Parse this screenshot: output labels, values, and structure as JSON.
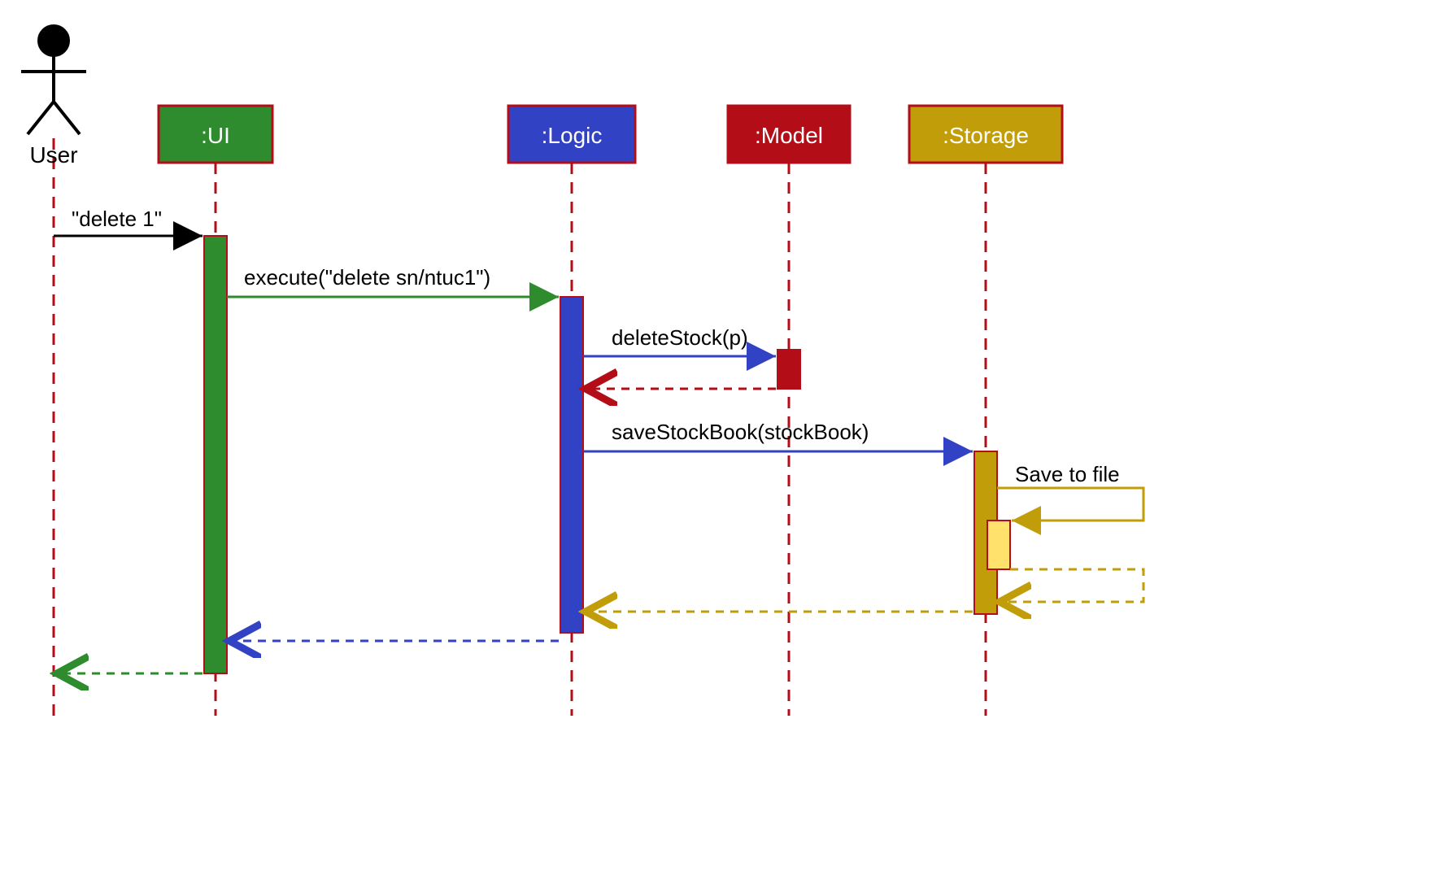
{
  "diagram": {
    "actor": {
      "label": "User"
    },
    "participants": {
      "ui": {
        "label": ":UI",
        "fill": "#2e8b2e",
        "stroke": "#b30d18"
      },
      "logic": {
        "label": ":Logic",
        "fill": "#3242c5",
        "stroke": "#b30d18"
      },
      "model": {
        "label": ":Model",
        "fill": "#b30d18",
        "stroke": "#b30d18"
      },
      "storage": {
        "label": ":Storage",
        "fill": "#c29d0a",
        "stroke": "#b30d18"
      }
    },
    "messages": {
      "m1": {
        "text": "\"delete 1\""
      },
      "m2": {
        "text": "execute(\"delete sn/ntuc1\")"
      },
      "m3": {
        "text": "deleteStock(p)"
      },
      "m4": {
        "text": "saveStockBook(stockBook)"
      },
      "m5": {
        "text": "Save to file"
      }
    },
    "colors": {
      "lifeline": "#b30d18",
      "ui": "#2e8b2e",
      "logic": "#3242c5",
      "model": "#b30d18",
      "storage": "#c29d0a",
      "storageLight": "#ffe16b",
      "black": "#000000"
    }
  }
}
